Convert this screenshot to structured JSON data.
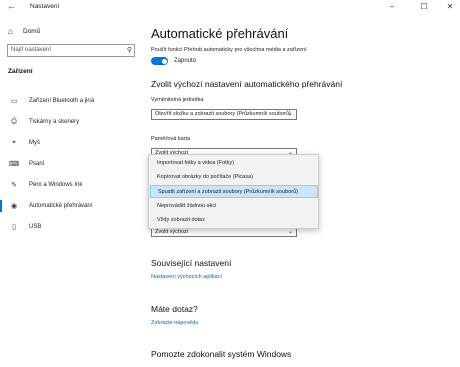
{
  "window": {
    "title": "Nastavení",
    "back_icon": "back-arrow-icon",
    "minimize": "–",
    "maximize": "☐",
    "close": "✕"
  },
  "sidebar": {
    "home_label": "Domů",
    "search_placeholder": "Najít nastavení",
    "section_title": "Zařízení",
    "items": [
      {
        "label": "Zařízení Bluetooth a jiná",
        "icon": "bluetooth-icon"
      },
      {
        "label": "Tiskárny a skenery",
        "icon": "printer-icon"
      },
      {
        "label": "Myš",
        "icon": "mouse-icon"
      },
      {
        "label": "Psaní",
        "icon": "keyboard-icon"
      },
      {
        "label": "Pero a Windows Ink",
        "icon": "pen-icon"
      },
      {
        "label": "Automatické přehrávání",
        "icon": "autoplay-icon",
        "active": true
      },
      {
        "label": "USB",
        "icon": "usb-icon"
      }
    ]
  },
  "main": {
    "title": "Automatické přehrávání",
    "use_autoplay_label": "Použít funkci Přehrát automaticky pro všechna média a zařízení",
    "toggle_state": "Zapnuto",
    "defaults_heading": "Zvolit výchozí nastavení automatického přehrávání",
    "removable_label": "Vyměnitelná jednotka",
    "removable_value": "Otevřít složku a zobrazit soubory (Průzkumník souborů)",
    "memory_card_label": "Paměťová karta",
    "memory_card_value": "Zvolit výchozí",
    "third_select_value": "Zvolit výchozí",
    "related_heading": "Související nastavení",
    "related_link": "Nastavení výchozích aplikací",
    "question_heading": "Máte dotaz?",
    "help_link": "Zobrazte nápovědu",
    "improve_heading": "Pomozte zdokonalit systém Windows"
  },
  "dropdown": {
    "options": [
      "Importovat fotky a videa (Fotky)",
      "Kopírovat obrázky do počítače (Picasa)",
      "Spustit zařízení a zobrazit soubory (Průzkumník souborů)",
      "Neprovádět žádnou akci",
      "Vždy zobrazit dotaz"
    ],
    "selected_index": 2
  },
  "colors": {
    "accent": "#0078d7",
    "link": "#0067b8",
    "selected_bg": "#cce4f7"
  }
}
